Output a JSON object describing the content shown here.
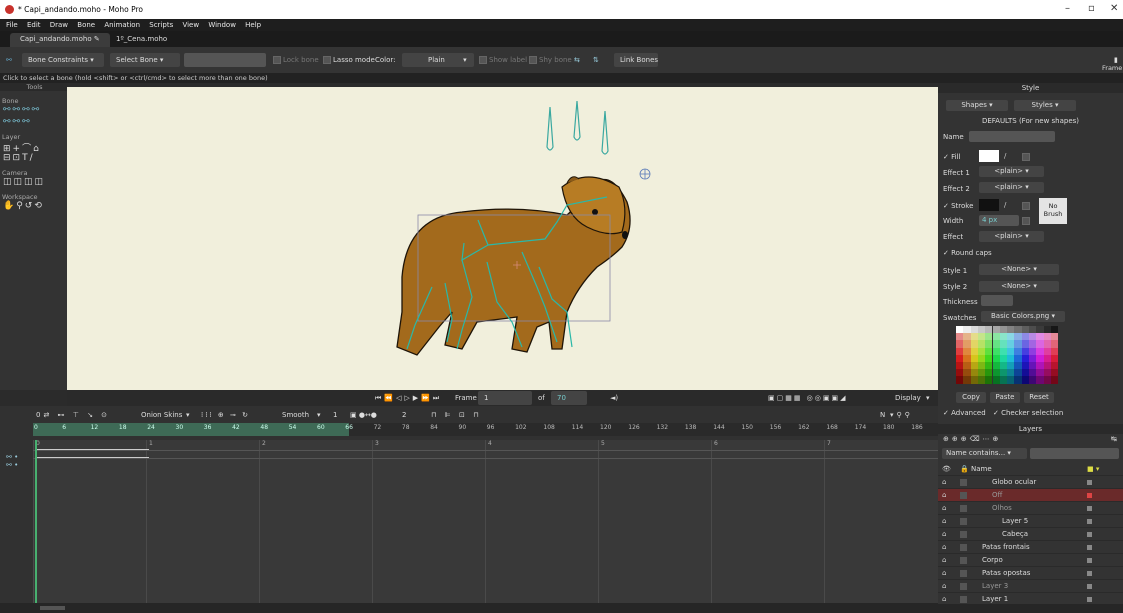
{
  "window": {
    "title": "* Capi_andando.moho - Moho Pro"
  },
  "menu": [
    "File",
    "Edit",
    "Draw",
    "Bone",
    "Animation",
    "Scripts",
    "View",
    "Window",
    "Help"
  ],
  "tabs": [
    "Capi_andando.moho",
    "1º_Cena.moho"
  ],
  "toolbar": {
    "bone_constraints": "Bone Constraints",
    "select_bone": "Select Bone",
    "lock_bone": "Lock bone",
    "lasso_mode": "Lasso mode",
    "color_label": "Color:",
    "color_value": "Plain",
    "show_label": "Show label",
    "shy_bone": "Shy bone",
    "link_bones": "Link Bones",
    "frame_label": "Frame"
  },
  "hint": "Click to select a bone (hold <shift> or <ctrl/cmd> to select more than one bone)",
  "tools": {
    "title": "Tools",
    "sections": [
      "Bone",
      "Layer",
      "Camera",
      "Workspace"
    ]
  },
  "playback": {
    "frame_label": "Frame",
    "frame_value": "1",
    "of_label": "of",
    "total": "70",
    "display": "Display"
  },
  "timeline": {
    "onion": "Onion Skins",
    "smooth": "Smooth",
    "interp_num": "1",
    "step": "2",
    "ruler": [
      "0",
      "6",
      "12",
      "18",
      "24",
      "30",
      "36",
      "42",
      "48",
      "54",
      "60",
      "66",
      "72",
      "78",
      "84",
      "90",
      "96",
      "102",
      "108",
      "114",
      "120",
      "126",
      "132",
      "138",
      "144",
      "150",
      "156",
      "162",
      "168",
      "174",
      "180",
      "186"
    ],
    "seconds": [
      "0",
      "1",
      "2",
      "3",
      "4",
      "5",
      "6",
      "7"
    ],
    "corner": "N"
  },
  "style": {
    "title": "Style",
    "shapes": "Shapes",
    "styles": "Styles",
    "defaults": "DEFAULTS (For new shapes)",
    "name": "Name",
    "fill": "Fill",
    "effect1": "Effect 1",
    "effect2": "Effect 2",
    "plain": "<plain>",
    "stroke": "Stroke",
    "no_brush": "No Brush",
    "width": "Width",
    "width_value": "4 px",
    "effect": "Effect",
    "round_caps": "Round caps",
    "style1": "Style 1",
    "style2": "Style 2",
    "none": "<None>",
    "thickness": "Thickness",
    "swatches": "Swatches",
    "swatch_file": "Basic Colors.png",
    "copy": "Copy",
    "paste": "Paste",
    "reset": "Reset",
    "advanced": "Advanced",
    "checker": "Checker selection"
  },
  "layers": {
    "title": "Layers",
    "filter": "Name contains...",
    "name_col": "Name",
    "rows": [
      {
        "name": "Globo ocular",
        "indent": 2
      },
      {
        "name": "Off",
        "indent": 2
      },
      {
        "name": "Olhos",
        "indent": 2
      },
      {
        "name": "Layer 5",
        "indent": 3
      },
      {
        "name": "Cabeça",
        "indent": 3
      },
      {
        "name": "Patas frontais",
        "indent": 1
      },
      {
        "name": "Corpo",
        "indent": 1
      },
      {
        "name": "Patas opostas",
        "indent": 1
      },
      {
        "name": "Layer 3",
        "indent": 1
      },
      {
        "name": "Layer 1",
        "indent": 1
      }
    ]
  }
}
